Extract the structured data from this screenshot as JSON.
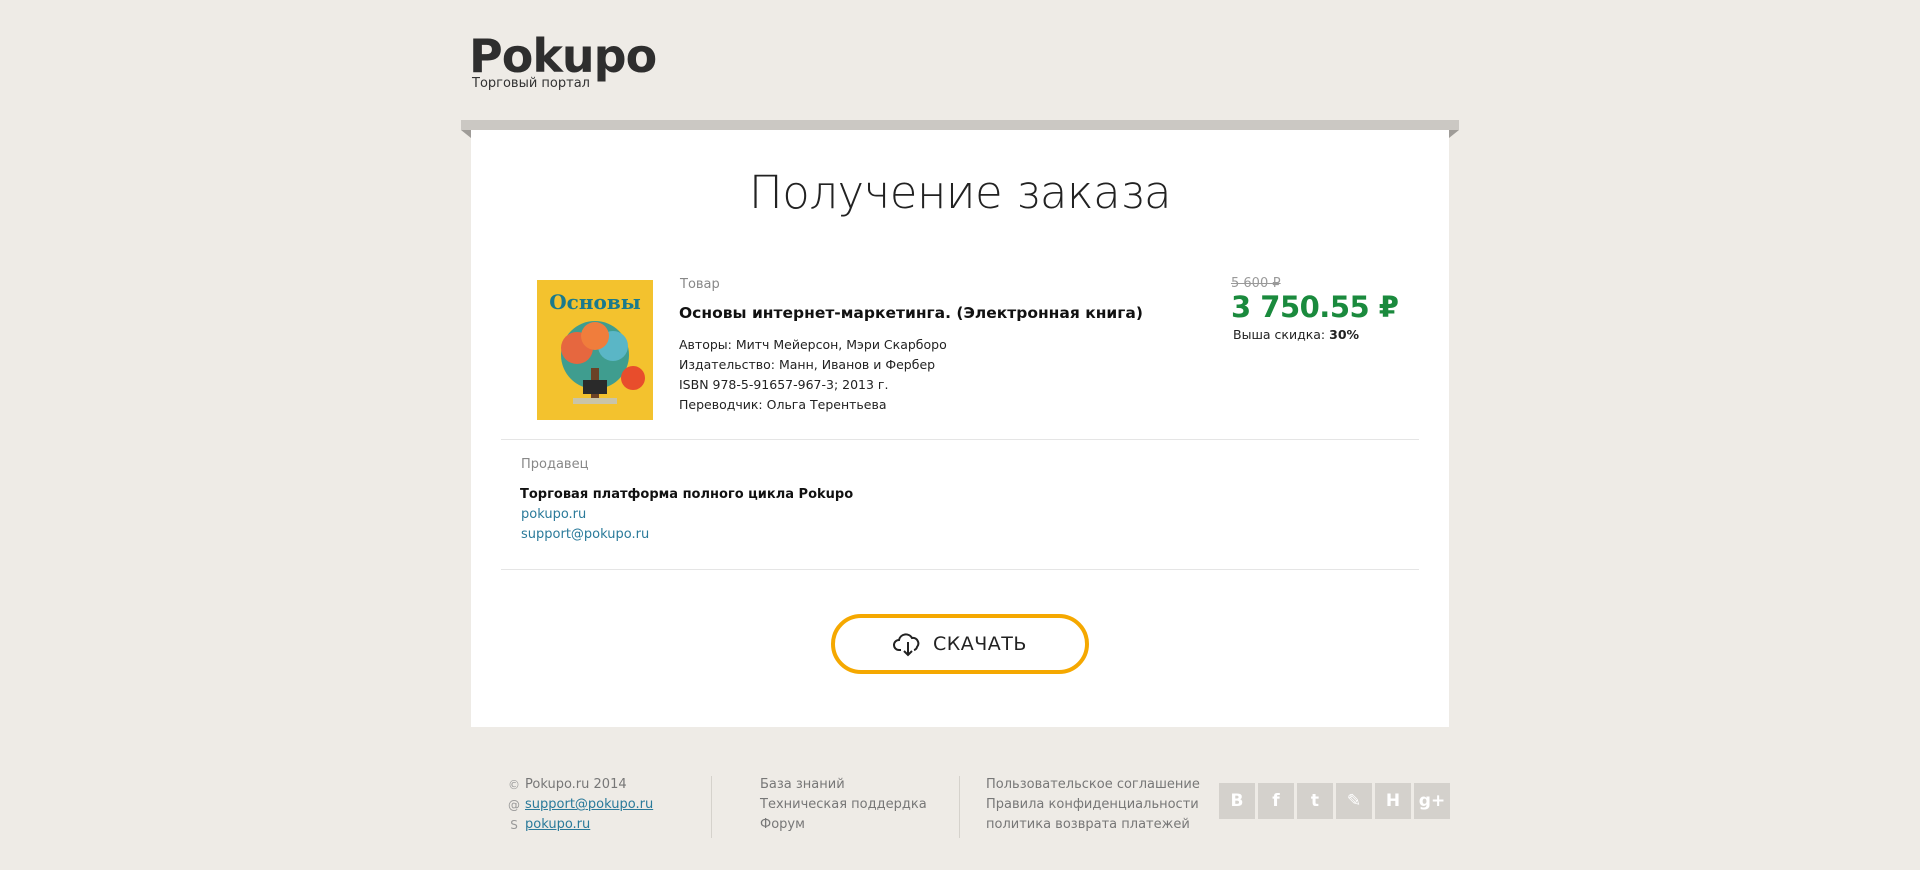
{
  "header": {
    "logo": "Pokupo",
    "tagline": "Торговый портал"
  },
  "page_title": "Получение заказа",
  "product": {
    "label": "Товар",
    "name": "Основы интернет-маркетинга. (Электронная книга)",
    "authors": "Авторы: Митч Мейерсон, Мэри Скарборо",
    "publisher": "Издательство: Манн, Иванов и Фербер",
    "isbn": "ISBN 978-5-91657-967-3; 2013 г.",
    "translator": "Переводчик: Ольга Терентьева",
    "cover_title": "Основы"
  },
  "price": {
    "old": "5 600 ₽",
    "new": "3 750.55 ₽",
    "discount_label": "Выша скидка:",
    "discount_value": "30%"
  },
  "seller": {
    "label": "Продавец",
    "name": "Торговая платформа полного цикла Pokupo",
    "site": "pokupo.ru",
    "email": "support@pokupo.ru"
  },
  "download_button": {
    "label": "СКАЧАТЬ"
  },
  "footer": {
    "copyright": "Pokupo.ru 2014",
    "email": "support@pokupo.ru",
    "skype": "pokupo.ru",
    "links_col2": [
      "База знаний",
      "Техническая поддердка",
      "Форум"
    ],
    "links_col3": [
      "Пользовательское соглашение",
      "Правила конфиденциальности",
      "политика возврата платежей"
    ],
    "socials": [
      {
        "icon": "vk-icon",
        "glyph": "B"
      },
      {
        "icon": "facebook-icon",
        "glyph": "f"
      },
      {
        "icon": "twitter-icon",
        "glyph": "t"
      },
      {
        "icon": "livejournal-icon",
        "glyph": "✎"
      },
      {
        "icon": "habr-icon",
        "glyph": "H"
      },
      {
        "icon": "googleplus-icon",
        "glyph": "g+"
      }
    ]
  },
  "colors": {
    "accent_button": "#f5a800",
    "price_green": "#1a8a3d",
    "link": "#2a7a9a",
    "background": "#eeebe6"
  }
}
